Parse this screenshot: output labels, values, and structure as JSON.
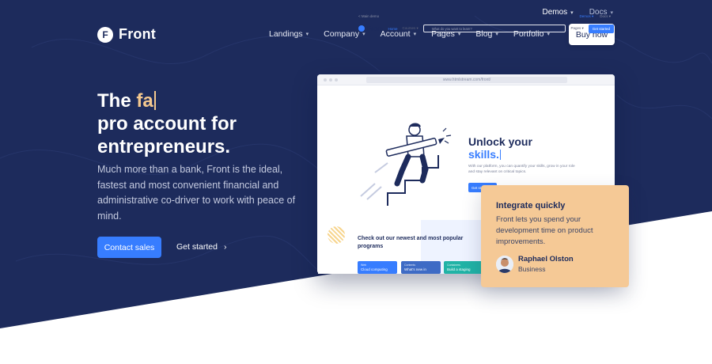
{
  "colors": {
    "hero_bg": "#1d2b5c",
    "accent": "#377dff",
    "highlight": "#f4c88f",
    "card_bg": "#f5c996"
  },
  "topnav": {
    "items": [
      {
        "label": "Demos",
        "icon": "chevron-down-icon"
      },
      {
        "label": "Docs",
        "icon": "chevron-down-icon"
      }
    ]
  },
  "header": {
    "logo_mark": "F",
    "logo_text": "Front",
    "nav": [
      {
        "label": "Landings",
        "icon": "chevron-down-icon"
      },
      {
        "label": "Company",
        "icon": "chevron-down-icon"
      },
      {
        "label": "Account",
        "icon": "chevron-down-icon"
      },
      {
        "label": "Pages",
        "icon": "chevron-down-icon"
      },
      {
        "label": "Blog",
        "icon": "chevron-down-icon"
      },
      {
        "label": "Portfolio",
        "icon": "chevron-down-icon"
      }
    ],
    "buy_now": "Buy now"
  },
  "hero": {
    "headline_prefix": "The ",
    "headline_typed": "fa",
    "headline_rest_1": "pro account for",
    "headline_rest_2": "entrepreneurs.",
    "lead": "Much more than a bank, Front is the ideal, fastest and most convenient financial and administrative co-driver to work with peace of mind.",
    "cta_primary": "Contact sales",
    "cta_secondary": "Get started",
    "cta_secondary_icon": "chevron-right-icon"
  },
  "mockup": {
    "url": "www.htmlstream.com/front/",
    "top_left": "< Main demo",
    "top_right_1": "Demos ▾",
    "top_right_2": "Docs ▾",
    "logo_text": "Front",
    "nav_home": "Home",
    "nav_courses": "Courses ▾",
    "search_placeholder": "What do you want to learn?",
    "nav_pages": "Pages ▾",
    "nav_get_started": "Get started",
    "unlock_title": "Unlock your",
    "unlock_typed": "skills.",
    "unlock_text": "With our platform, you can quantify your skills, grow in your role and stay relevant on critical topics.",
    "unlock_button": "Get started",
    "programs_title": "Check out our newest and most popular programs",
    "cards": [
      {
        "tag": "Web",
        "title": "Cloud computing"
      },
      {
        "tag": "Contents",
        "title": "What's new in"
      },
      {
        "tag": "Containers",
        "title": "Build a staging"
      }
    ]
  },
  "testimonial": {
    "title": "Integrate quickly",
    "text": "Front lets you spend your development time on product improvements.",
    "name": "Raphael Olston",
    "role": "Business"
  }
}
